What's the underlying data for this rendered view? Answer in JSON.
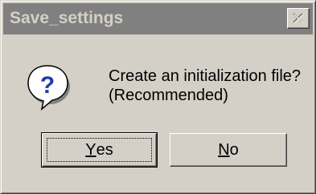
{
  "window": {
    "title": "Save_settings",
    "close_icon": "close-x-icon"
  },
  "message": {
    "icon": "question-icon",
    "line1": "Create an initialization file?",
    "line2": "(Recommended)"
  },
  "buttons": {
    "yes": {
      "mnemonic": "Y",
      "rest": "es",
      "focused": true
    },
    "no": {
      "mnemonic": "N",
      "rest": "o",
      "focused": false
    }
  },
  "colors": {
    "face": "#d4d0c8",
    "titlebar_inactive": "#808080",
    "icon_blue": "#1c3ea8"
  }
}
